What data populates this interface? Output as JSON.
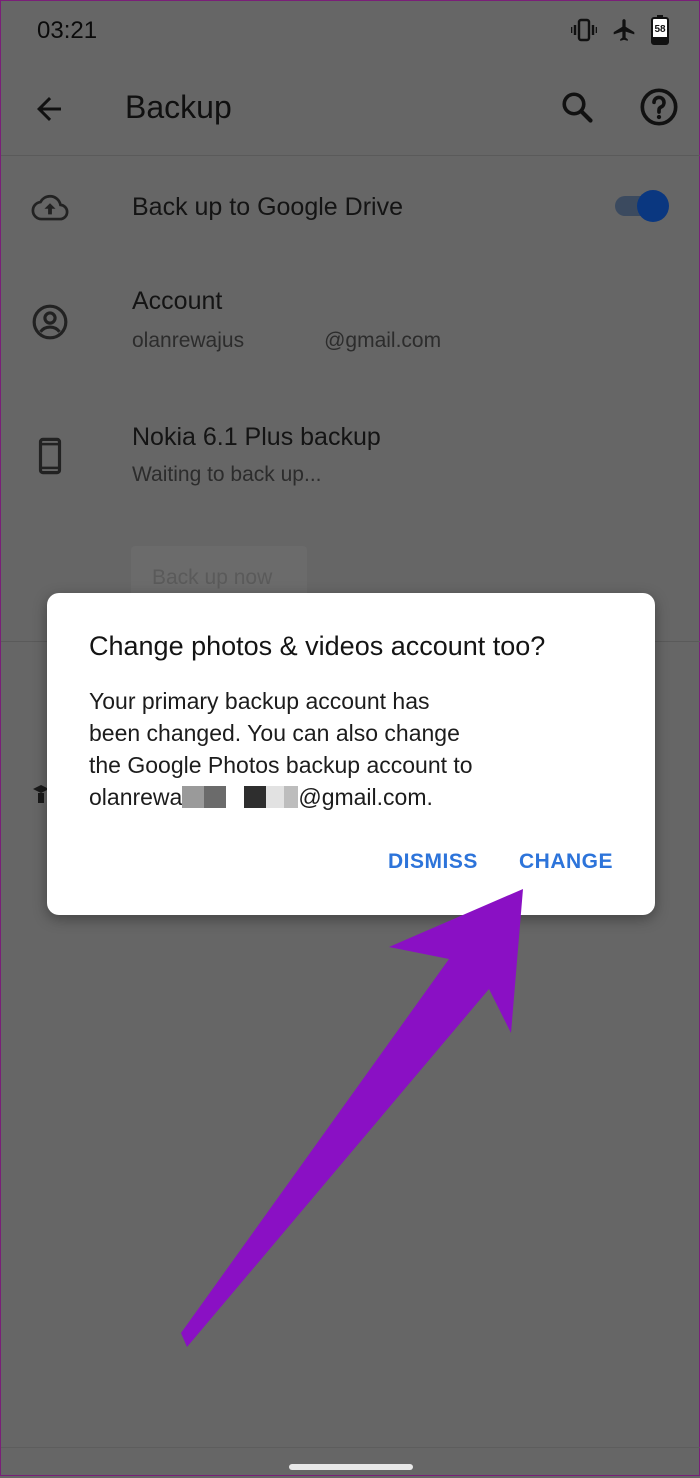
{
  "status_bar": {
    "time": "03:21",
    "battery_level": "58",
    "icons": [
      "vibrate-icon",
      "airplane-mode-icon",
      "battery-icon"
    ]
  },
  "app_bar": {
    "title": "Backup",
    "icons": [
      "back-arrow-icon",
      "search-icon",
      "help-icon"
    ]
  },
  "settings": {
    "drive_backup": {
      "label": "Back up to Google Drive",
      "icon": "cloud-upload-icon",
      "toggle_on": true
    },
    "account": {
      "label": "Account",
      "email_user": "olanrewajus",
      "email_domain": "@gmail.com",
      "icon": "account-circle-icon"
    },
    "device": {
      "label": "Nokia 6.1 Plus backup",
      "status": "Waiting to back up...",
      "icon": "phone-icon"
    },
    "backup_now_label": "Back up now"
  },
  "dialog": {
    "title": "Change photos & videos account too?",
    "body_lines": [
      "Your primary backup account has",
      "been changed. You can also change",
      "the Google Photos backup account to"
    ],
    "email_user": "olanrewa",
    "email_domain": "@gmail.com.",
    "dismiss_label": "DISMISS",
    "change_label": "CHANGE"
  },
  "colors": {
    "accent": "#2d74da",
    "overlay": "#666666",
    "toggle": "#0a3780",
    "annotation_arrow": "#8a10c4"
  }
}
